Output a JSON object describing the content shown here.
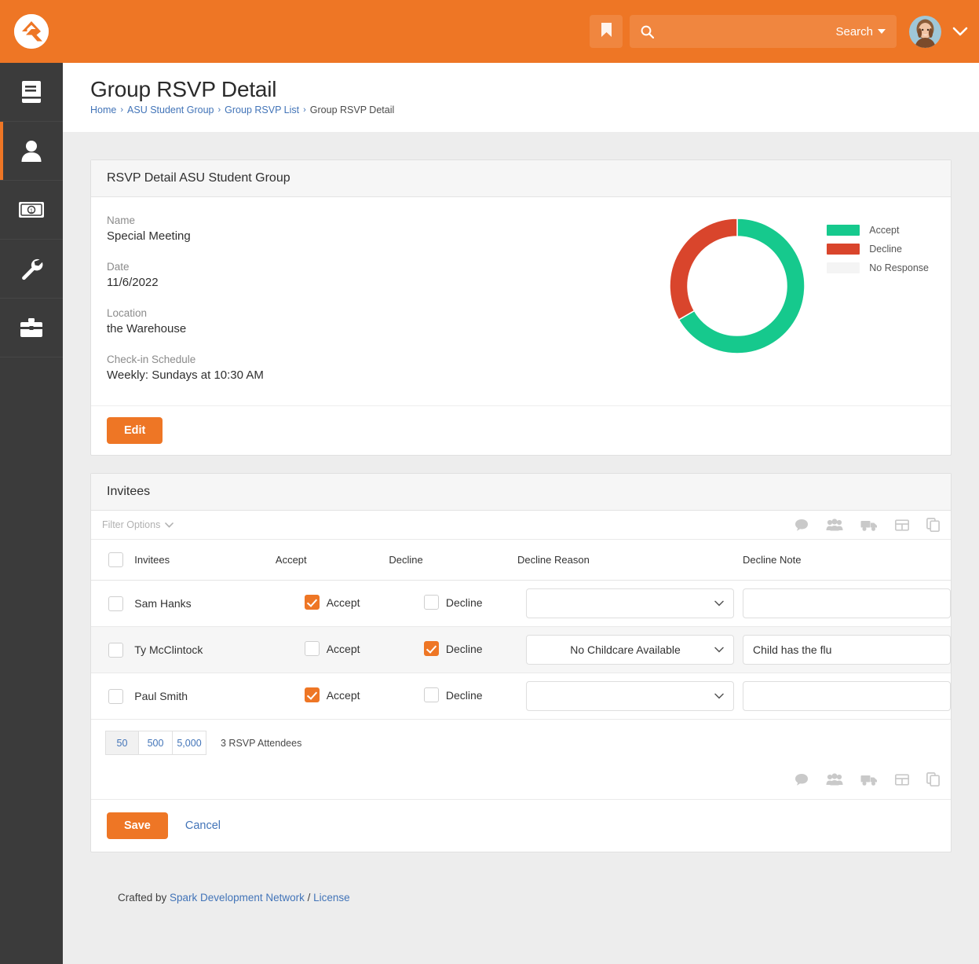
{
  "topbar": {
    "logo_name": "rock-rms-logo",
    "bookmark_icon": "bookmark-icon",
    "search_icon": "search-icon",
    "search_value": "",
    "search_placeholder": "",
    "search_label": "Search",
    "avatar_name": "user-avatar",
    "user_menu_icon": "chevron-down-icon",
    "brand_color": "#ee7625"
  },
  "sidebar": {
    "items": [
      {
        "name": "sidebar-item-cms",
        "icon": "book-icon",
        "active": false
      },
      {
        "name": "sidebar-item-people",
        "icon": "person-icon",
        "active": true
      },
      {
        "name": "sidebar-item-finance",
        "icon": "money-bill-icon",
        "active": false
      },
      {
        "name": "sidebar-item-admin",
        "icon": "wrench-icon",
        "active": false
      },
      {
        "name": "sidebar-item-tools",
        "icon": "toolbox-icon",
        "active": false
      }
    ]
  },
  "header": {
    "title": "Group RSVP Detail",
    "breadcrumb": [
      {
        "label": "Home",
        "link": true
      },
      {
        "label": "ASU Student Group",
        "link": true
      },
      {
        "label": "Group RSVP List",
        "link": true
      },
      {
        "label": "Group RSVP Detail",
        "link": false
      }
    ],
    "breadcrumb_separator": "›"
  },
  "detail_panel": {
    "title": "RSVP Detail ASU Student Group",
    "fields": [
      {
        "label": "Name",
        "value": "Special Meeting"
      },
      {
        "label": "Date",
        "value": "11/6/2022"
      },
      {
        "label": "Location",
        "value": "the Warehouse"
      },
      {
        "label": "Check-in Schedule",
        "value": "Weekly: Sundays at 10:30 AM"
      }
    ],
    "edit_label": "Edit"
  },
  "chart_data": {
    "type": "pie",
    "title": "",
    "donut": true,
    "categories": [
      "Accept",
      "Decline",
      "No Response"
    ],
    "values": [
      2,
      1,
      0
    ],
    "percentages": [
      66.7,
      33.3,
      0
    ],
    "colors": [
      "#16c98d",
      "#d9452c",
      "#f4f4f4"
    ],
    "legend_position": "right",
    "start_angle_deg": 0,
    "direction": "clockwise"
  },
  "invitees_panel": {
    "title": "Invitees",
    "filter_options_label": "Filter Options",
    "grid_action_icons": [
      "comment-icon",
      "group-people-icon",
      "truck-icon",
      "excel-table-icon",
      "copy-icon"
    ],
    "columns": [
      "",
      "Invitees",
      "Accept",
      "Decline",
      "Decline Reason",
      "Decline Note"
    ],
    "rows": [
      {
        "name": "Sam Hanks",
        "accept_checked": true,
        "accept_label": "Accept",
        "decline_checked": false,
        "decline_label": "Decline",
        "decline_reason": "",
        "decline_note": "",
        "decline_note_placeholder": ""
      },
      {
        "name": "Ty McClintock",
        "accept_checked": false,
        "accept_label": "Accept",
        "decline_checked": true,
        "decline_label": "Decline",
        "decline_reason": "No Childcare Available",
        "decline_note": "Child has the flu",
        "decline_note_placeholder": ""
      },
      {
        "name": "Paul Smith",
        "accept_checked": true,
        "accept_label": "Accept",
        "decline_checked": false,
        "decline_label": "Decline",
        "decline_reason": "",
        "decline_note": "",
        "decline_note_placeholder": ""
      }
    ],
    "page_sizes": [
      "50",
      "500",
      "5,000"
    ],
    "active_page_size": "50",
    "result_count_text": "3 RSVP Attendees",
    "save_label": "Save",
    "cancel_label": "Cancel"
  },
  "footer": {
    "prefix": "Crafted by ",
    "org_link": "Spark Development Network",
    "divider": " / ",
    "license_link": "License"
  }
}
